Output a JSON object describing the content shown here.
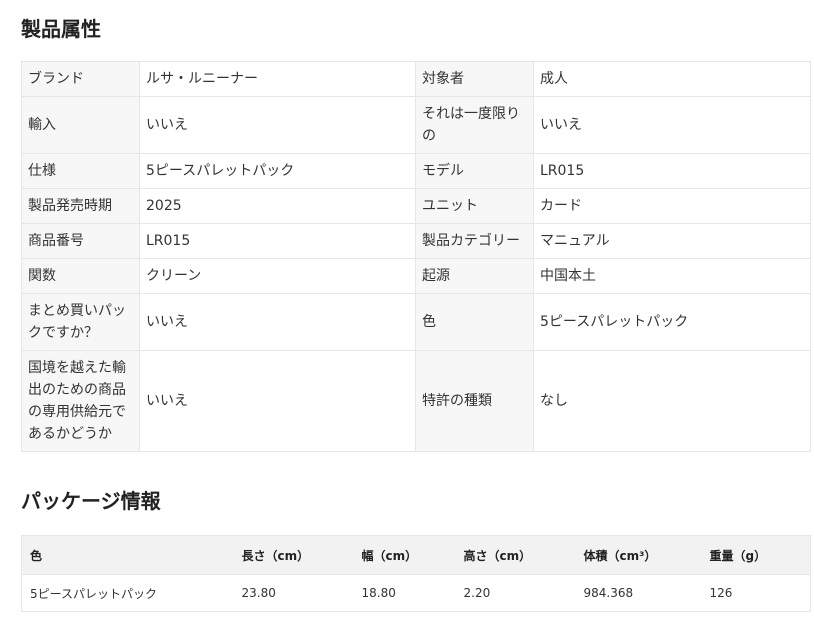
{
  "product_attributes": {
    "title": "製品属性",
    "rows": [
      [
        "ブランド",
        "ルサ・ルニーナー",
        "対象者",
        "成人"
      ],
      [
        "輸入",
        "いいえ",
        "それは一度限りの",
        "いいえ"
      ],
      [
        "仕様",
        "5ピースパレットパック",
        "モデル",
        "LR015"
      ],
      [
        "製品発売時期",
        "2025",
        "ユニット",
        "カード"
      ],
      [
        "商品番号",
        "LR015",
        "製品カテゴリー",
        "マニュアル"
      ],
      [
        "関数",
        "クリーン",
        "起源",
        "中国本土"
      ],
      [
        "まとめ買いパックですか？",
        "いいえ",
        "色",
        "5ピースパレットパック"
      ],
      [
        "国境を越えた輸出のための商品の専用供給元であるかどうか",
        "いいえ",
        "特許の種類",
        "なし"
      ]
    ]
  },
  "package_info": {
    "title": "パッケージ情報",
    "headers": [
      "色",
      "長さ（cm）",
      "幅（cm）",
      "高さ（cm）",
      "体積（cm³）",
      "重量（g）"
    ],
    "rows": [
      [
        "5ピースパレットパック",
        "23.80",
        "18.80",
        "2.20",
        "984.368",
        "126"
      ]
    ]
  }
}
